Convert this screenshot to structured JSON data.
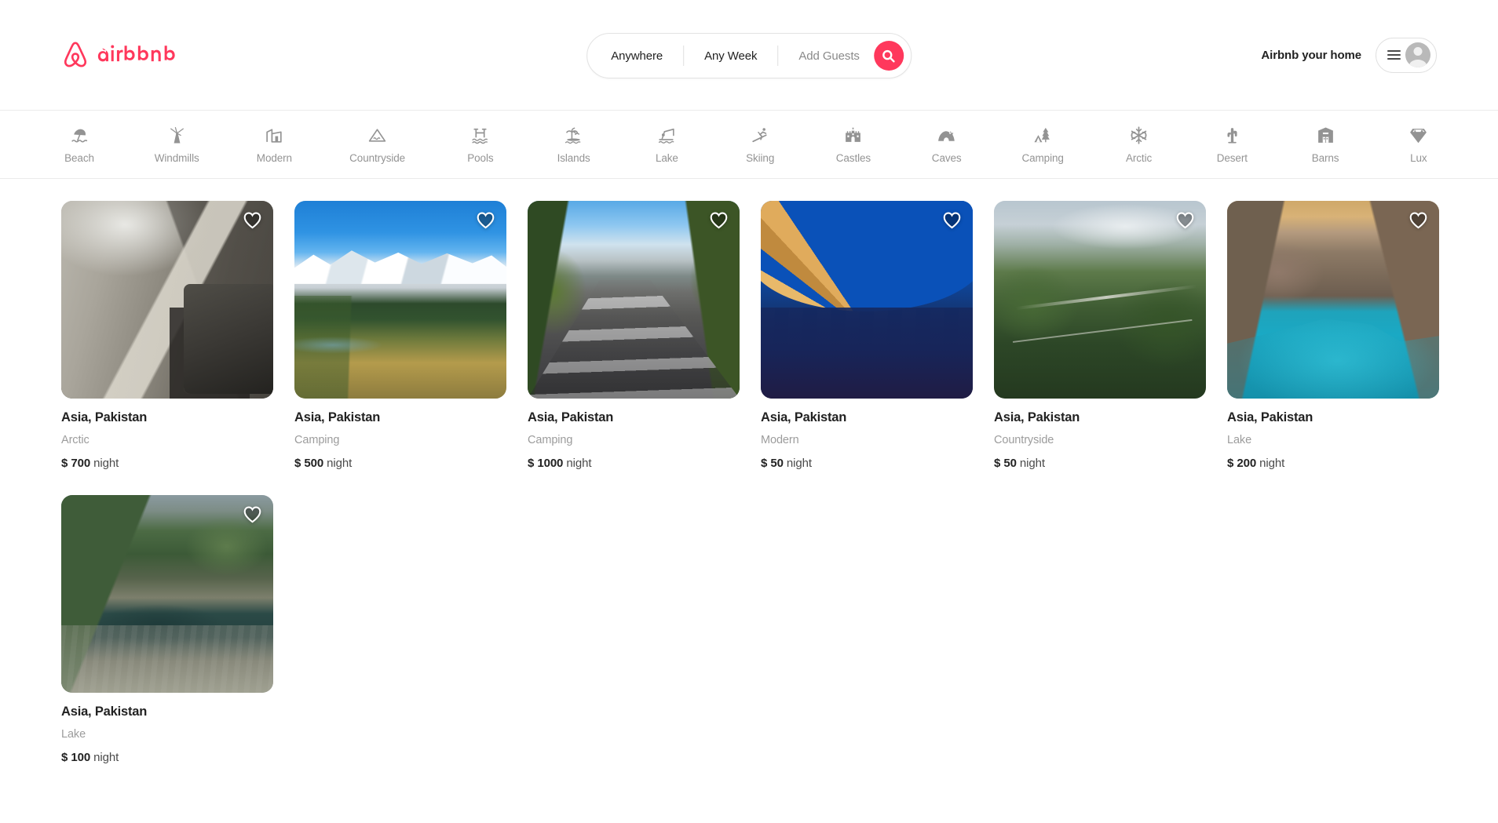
{
  "header": {
    "logo_text": "airbnb",
    "brand_color": "#FF385C",
    "search": {
      "location": "Anywhere",
      "dates": "Any Week",
      "guests": "Add Guests",
      "search_icon": "search-icon"
    },
    "host_link": "Airbnb your home",
    "menu_icon": "hamburger-icon",
    "avatar_icon": "user-avatar-icon"
  },
  "categories": [
    {
      "label": "Beach",
      "icon": "beach-umbrella-icon"
    },
    {
      "label": "Windmills",
      "icon": "windmill-icon"
    },
    {
      "label": "Modern",
      "icon": "modern-building-icon"
    },
    {
      "label": "Countryside",
      "icon": "mountain-icon"
    },
    {
      "label": "Pools",
      "icon": "pool-icon"
    },
    {
      "label": "Islands",
      "icon": "island-palm-icon"
    },
    {
      "label": "Lake",
      "icon": "fishing-lake-icon"
    },
    {
      "label": "Skiing",
      "icon": "skier-icon"
    },
    {
      "label": "Castles",
      "icon": "castle-icon"
    },
    {
      "label": "Caves",
      "icon": "cave-icon"
    },
    {
      "label": "Camping",
      "icon": "tent-tree-icon"
    },
    {
      "label": "Arctic",
      "icon": "snowflake-icon"
    },
    {
      "label": "Desert",
      "icon": "cactus-icon"
    },
    {
      "label": "Barns",
      "icon": "barn-icon"
    },
    {
      "label": "Lux",
      "icon": "diamond-icon"
    }
  ],
  "listings": [
    {
      "title": "Asia, Pakistan",
      "category": "Arctic",
      "currency": "$",
      "price": "700",
      "period": "night",
      "photo": "ph-jeep",
      "favorite_icon": "heart-icon"
    },
    {
      "title": "Asia, Pakistan",
      "category": "Camping",
      "currency": "$",
      "price": "500",
      "period": "night",
      "photo": "ph-nanga",
      "favorite_icon": "heart-icon"
    },
    {
      "title": "Asia, Pakistan",
      "category": "Camping",
      "currency": "$",
      "price": "1000",
      "period": "night",
      "photo": "ph-road",
      "favorite_icon": "heart-icon"
    },
    {
      "title": "Asia, Pakistan",
      "category": "Modern",
      "currency": "$",
      "price": "50",
      "period": "night",
      "photo": "ph-monument",
      "favorite_icon": "heart-icon"
    },
    {
      "title": "Asia, Pakistan",
      "category": "Countryside",
      "currency": "$",
      "price": "50",
      "period": "night",
      "photo": "ph-valley",
      "favorite_icon": "heart-icon"
    },
    {
      "title": "Asia, Pakistan",
      "category": "Lake",
      "currency": "$",
      "price": "200",
      "period": "night",
      "photo": "ph-attabad",
      "favorite_icon": "heart-icon"
    },
    {
      "title": "Asia, Pakistan",
      "category": "Lake",
      "currency": "$",
      "price": "100",
      "period": "night",
      "photo": "ph-saiful",
      "favorite_icon": "heart-icon"
    }
  ]
}
